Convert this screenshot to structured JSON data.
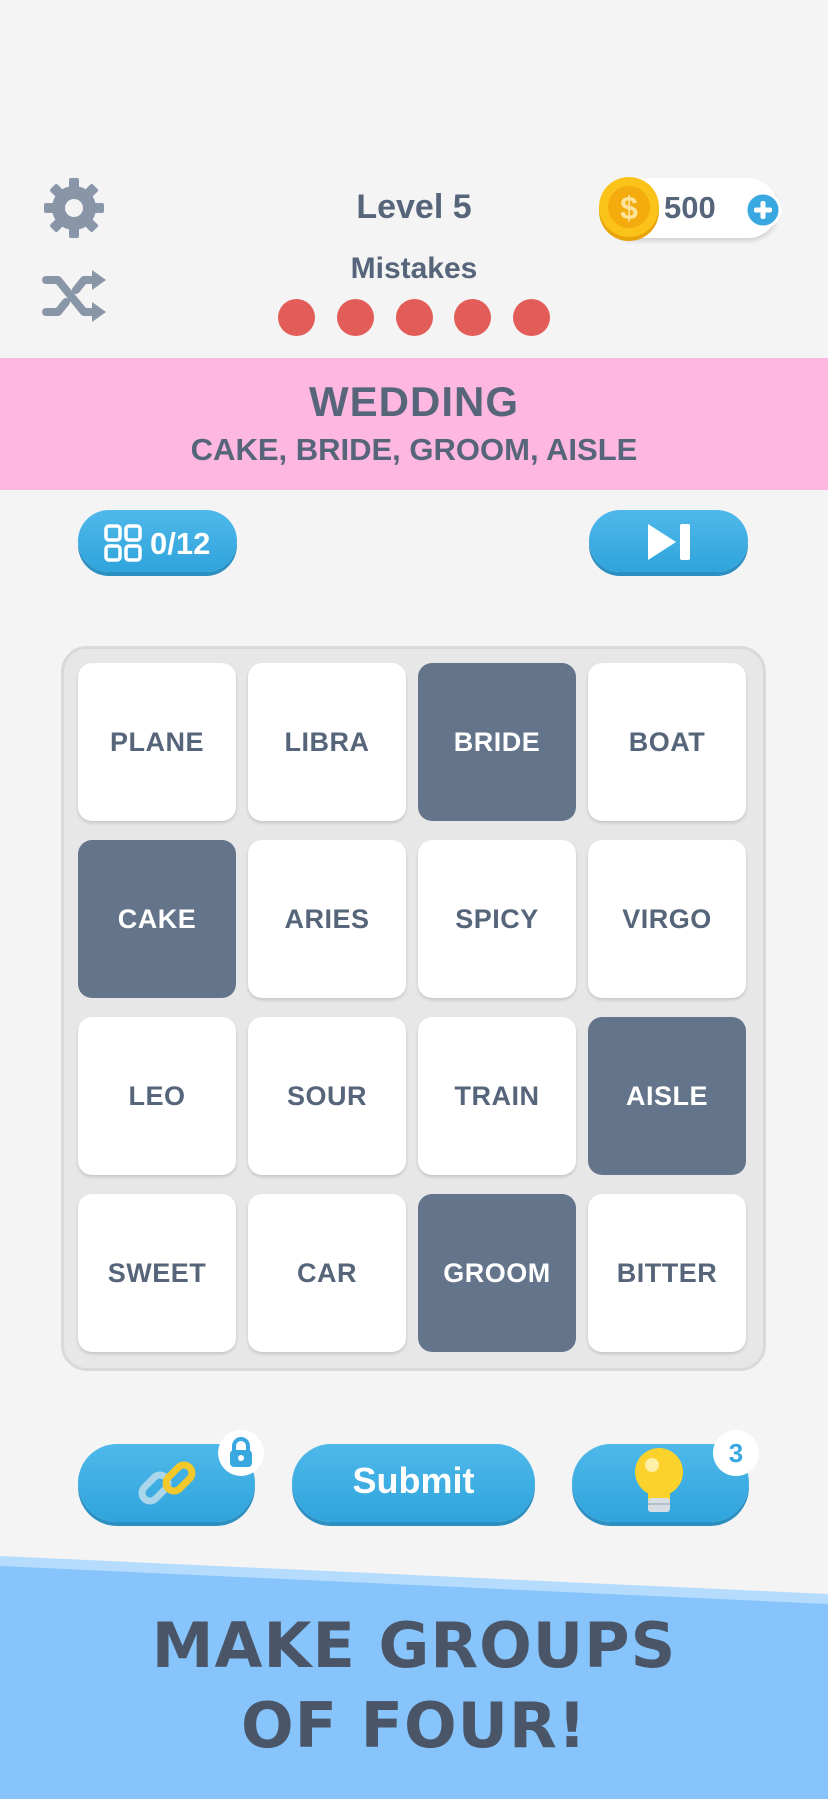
{
  "header": {
    "level_title": "Level 5",
    "mistakes_label": "Mistakes",
    "mistakes_remaining": 5,
    "coins": "500",
    "settings_icon": "gear-icon",
    "shuffle_icon": "shuffle-icon",
    "coin_icon": "coin-icon",
    "add_coins_icon": "plus-icon"
  },
  "solved_group": {
    "name": "WEDDING",
    "words": "CAKE, BRIDE, GROOM, AISLE",
    "color": "#fdb7e0"
  },
  "progress": {
    "text": "0/12",
    "icon": "grid-icon"
  },
  "skip": {
    "icon": "skip-icon"
  },
  "board": {
    "tiles": [
      {
        "word": "PLANE",
        "selected": false
      },
      {
        "word": "LIBRA",
        "selected": false
      },
      {
        "word": "BRIDE",
        "selected": true
      },
      {
        "word": "BOAT",
        "selected": false
      },
      {
        "word": "CAKE",
        "selected": true
      },
      {
        "word": "ARIES",
        "selected": false
      },
      {
        "word": "SPICY",
        "selected": false
      },
      {
        "word": "VIRGO",
        "selected": false
      },
      {
        "word": "LEO",
        "selected": false
      },
      {
        "word": "SOUR",
        "selected": false
      },
      {
        "word": "TRAIN",
        "selected": false
      },
      {
        "word": "AISLE",
        "selected": true
      },
      {
        "word": "SWEET",
        "selected": false
      },
      {
        "word": "CAR",
        "selected": false
      },
      {
        "word": "GROOM",
        "selected": true
      },
      {
        "word": "BITTER",
        "selected": false
      }
    ],
    "selected_color": "#64748a",
    "tile_color": "#ffffff"
  },
  "controls": {
    "submit_label": "Submit",
    "hint_count": "3",
    "link_icon": "chain-link-icon",
    "lock_icon": "lock-icon",
    "hint_icon": "lightbulb-icon"
  },
  "banner": {
    "line1": "MAKE GROUPS",
    "line2": "OF FOUR!"
  },
  "colors": {
    "accent": "#3aa8e0",
    "mistake_dot": "#e35d58",
    "banner_bg": "#86c4fb"
  }
}
